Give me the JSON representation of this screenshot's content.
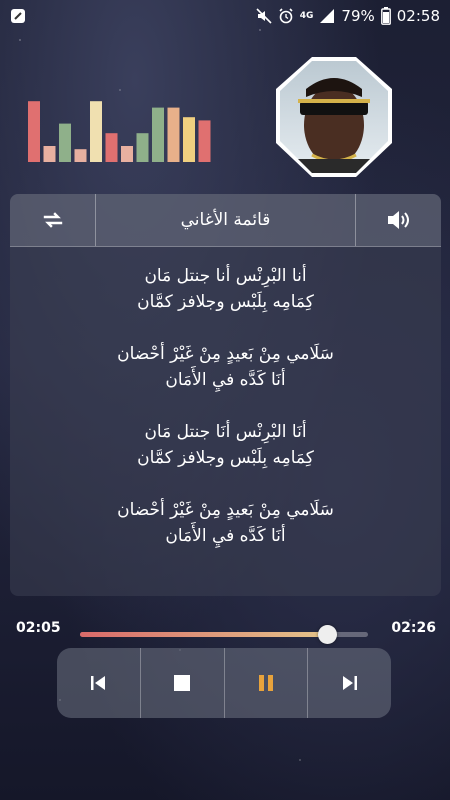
{
  "statusbar": {
    "network": "4G",
    "battery": "79%",
    "time": "02:58"
  },
  "equalizer": {
    "levels": [
      0.95,
      0.25,
      0.6,
      0.2,
      0.95,
      0.45,
      0.25,
      0.45,
      0.85,
      0.85,
      0.7,
      0.65
    ],
    "colors": [
      "#e07070",
      "#e8b0a0",
      "#8fb08a",
      "#e8b0a0",
      "#f0e0b0",
      "#e07070",
      "#e8b0a0",
      "#8fb08a",
      "#8fb08a",
      "#e8b08a",
      "#f0d080",
      "#e07070"
    ]
  },
  "header": {
    "title": "قائمة الأغاني",
    "left_icon": "repeat-icon",
    "right_icon": "volume-icon"
  },
  "lyrics": [
    [
      "أنا البْرِنْس أنا جنتل مَان",
      "كِمَامِه بِلَبْس وجلافز كمَّان"
    ],
    [
      "سَلَامي مِنْ بَعيدٍ مِنْ غَيْرْ أحْضان",
      "أنَا كَدَّه فيِ الأَمَان"
    ],
    [
      "أنَا البْرِنْس أنَا جنتل مَان",
      "كِمَامِه بِلَبْس وجلافز كمَّان"
    ],
    [
      "سَلَامي مِنْ بَعيدٍ مِنْ غَيْرْ أحْضان",
      "أنَا كَدَّه فيِ الأَمَان"
    ]
  ],
  "player": {
    "current_time": "02:05",
    "total_time": "02:26",
    "progress": 0.856
  },
  "controls": {
    "accent": "#e8a33c",
    "buttons": [
      "previous-icon",
      "stop-icon",
      "pause-icon",
      "next-icon"
    ]
  }
}
